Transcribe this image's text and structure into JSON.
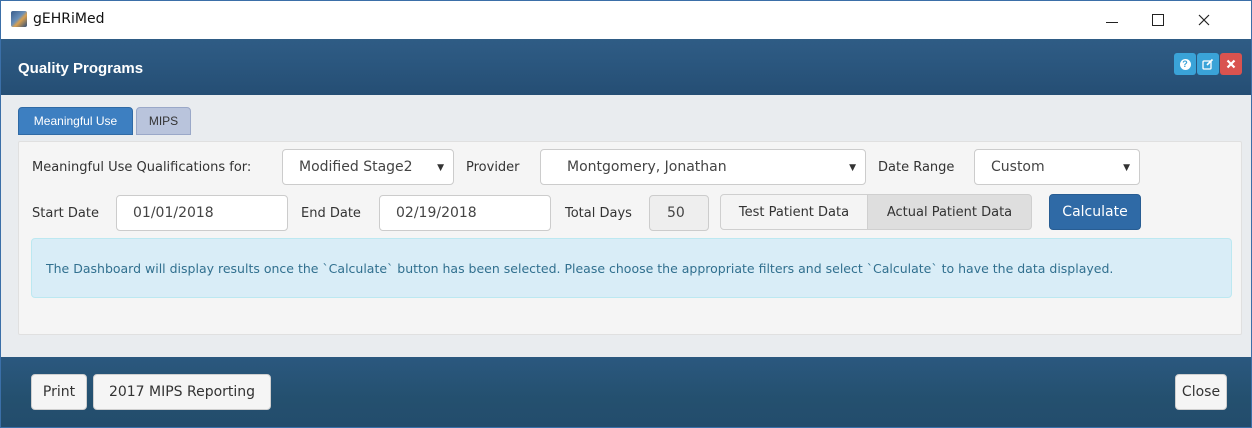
{
  "window": {
    "app_title": "gEHRiMed"
  },
  "dialog": {
    "title": "Quality Programs",
    "header_buttons": {
      "help_icon": "help-icon",
      "edit_icon": "edit-icon",
      "close_icon": "close-icon"
    }
  },
  "tabs": [
    {
      "label": "Meaningful Use",
      "active": true
    },
    {
      "label": "MIPS",
      "active": false
    }
  ],
  "filters": {
    "qualifications_label": "Meaningful Use Qualifications for:",
    "qualifications_value": "Modified Stage2",
    "provider_label": "Provider",
    "provider_value": "Montgomery, Jonathan",
    "date_range_label": "Date Range",
    "date_range_value": "Custom",
    "start_date_label": "Start Date",
    "start_date_value": "01/01/2018",
    "end_date_label": "End Date",
    "end_date_value": "02/19/2018",
    "total_days_label": "Total Days",
    "total_days_value": "50",
    "test_patient_label": "Test Patient Data",
    "actual_patient_label": "Actual Patient Data",
    "calculate_label": "Calculate"
  },
  "alert": {
    "message": "The Dashboard will display results once the `Calculate` button has been selected. Please choose the appropriate filters and select `Calculate` to have the data displayed."
  },
  "footer": {
    "print_label": "Print",
    "mips_reporting_label": "2017 MIPS Reporting",
    "close_label": "Close"
  },
  "colors": {
    "header_bg": "#2b577f",
    "primary_button": "#2f6aa6",
    "help_button": "#3aa3d8",
    "close_button": "#d9534f",
    "alert_bg": "#d9edf7",
    "alert_text": "#31708f"
  }
}
